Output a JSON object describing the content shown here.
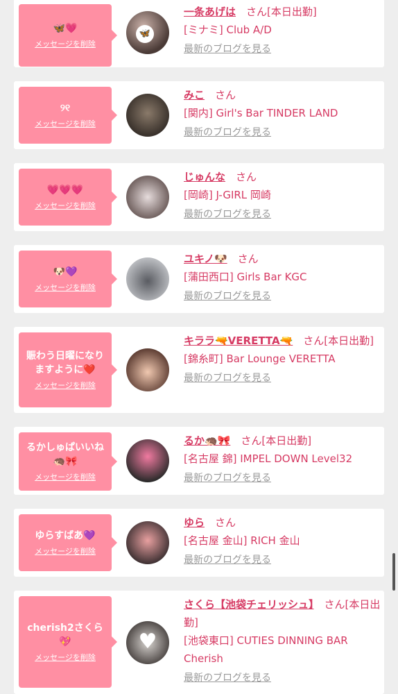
{
  "delete_label": "メッセージを削除",
  "blog_label": "最新のブログを見る",
  "cards": [
    {
      "message": "🦋💗",
      "name": "一条あげは",
      "san": "さん[本日出勤]",
      "shop": "[ミナミ] Club A/D"
    },
    {
      "message": "୨୧",
      "name": "みこ",
      "san": "さん",
      "shop": "[関内] Girl's Bar TINDER LAND"
    },
    {
      "message": "💗💗💗",
      "name": "じゅんな",
      "san": "さん",
      "shop": "[岡崎] J-GIRL 岡崎"
    },
    {
      "message": "🐶💜",
      "name": "ユキノ🐶",
      "san": "さん",
      "shop": "[蒲田西口] Girls Bar KGC"
    },
    {
      "message": "賑わう日曜になり\nますように❤️",
      "name": "キララ🔫VERETTA🔫",
      "san": "さん[本日出勤]",
      "shop": "[錦糸町] Bar Lounge VERETTA"
    },
    {
      "message": "るかしゅぱいいね\n🦔🎀",
      "name": "るか🦔🎀",
      "san": "さん[本日出勤]",
      "shop": "[名古屋 錦] IMPEL DOWN Level32"
    },
    {
      "message": "ゆらすばあ💜",
      "name": "ゆら",
      "san": "さん",
      "shop": "[名古屋 金山] RICH 金山"
    },
    {
      "message": "cherish2さくら\n💖",
      "name": "さくら【池袋チェリッシュ】",
      "san": "さん[本日出勤]",
      "shop": "[池袋東口] CUTIES DINNING BAR Cherish"
    }
  ]
}
